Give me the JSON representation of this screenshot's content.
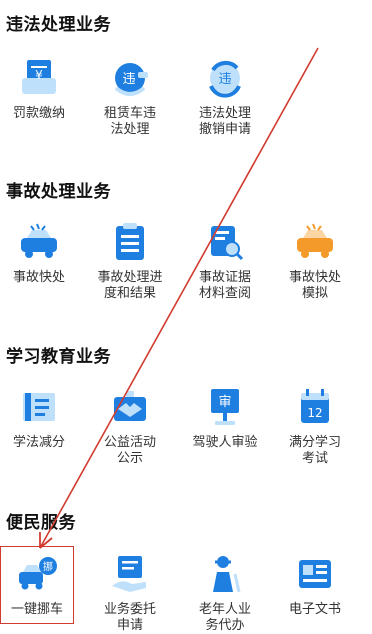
{
  "sections": [
    {
      "title": "违法处理业务",
      "items": [
        {
          "label": "罚款缴纳",
          "icon": "fine-payment-icon"
        },
        {
          "label": "租赁车违\n法处理",
          "icon": "rental-violation-icon"
        },
        {
          "label": "违法处理\n撤销申请",
          "icon": "violation-revoke-icon"
        }
      ]
    },
    {
      "title": "事故处理业务",
      "items": [
        {
          "label": "事故快处",
          "icon": "accident-quick-icon"
        },
        {
          "label": "事故处理进\n度和结果",
          "icon": "accident-progress-icon"
        },
        {
          "label": "事故证据\n材料查阅",
          "icon": "evidence-search-icon"
        },
        {
          "label": "事故快处\n模拟",
          "icon": "accident-sim-icon"
        }
      ]
    },
    {
      "title": "学习教育业务",
      "items": [
        {
          "label": "学法减分",
          "icon": "study-book-icon"
        },
        {
          "label": "公益活动\n公示",
          "icon": "charity-icon"
        },
        {
          "label": "驾驶人审验",
          "icon": "driver-review-icon"
        },
        {
          "label": "满分学习\n考试",
          "icon": "full-score-exam-icon"
        }
      ]
    },
    {
      "title": "便民服务",
      "items": [
        {
          "label": "一键挪车",
          "icon": "move-car-icon"
        },
        {
          "label": "业务委托\n申请",
          "icon": "entrust-icon"
        },
        {
          "label": "老年人业\n务代办",
          "icon": "elderly-icon"
        },
        {
          "label": "电子文书",
          "icon": "e-document-icon"
        }
      ]
    }
  ],
  "icon_text": {
    "fine": "¥",
    "rental": "违",
    "revoke": "违",
    "driver": "审",
    "exam": "12",
    "move": "挪"
  },
  "colors": {
    "primary_blue": "#1f7fe0",
    "light_blue": "#bfe0fb",
    "orange": "#f39a2b",
    "highlight_red": "#d23b2f"
  }
}
